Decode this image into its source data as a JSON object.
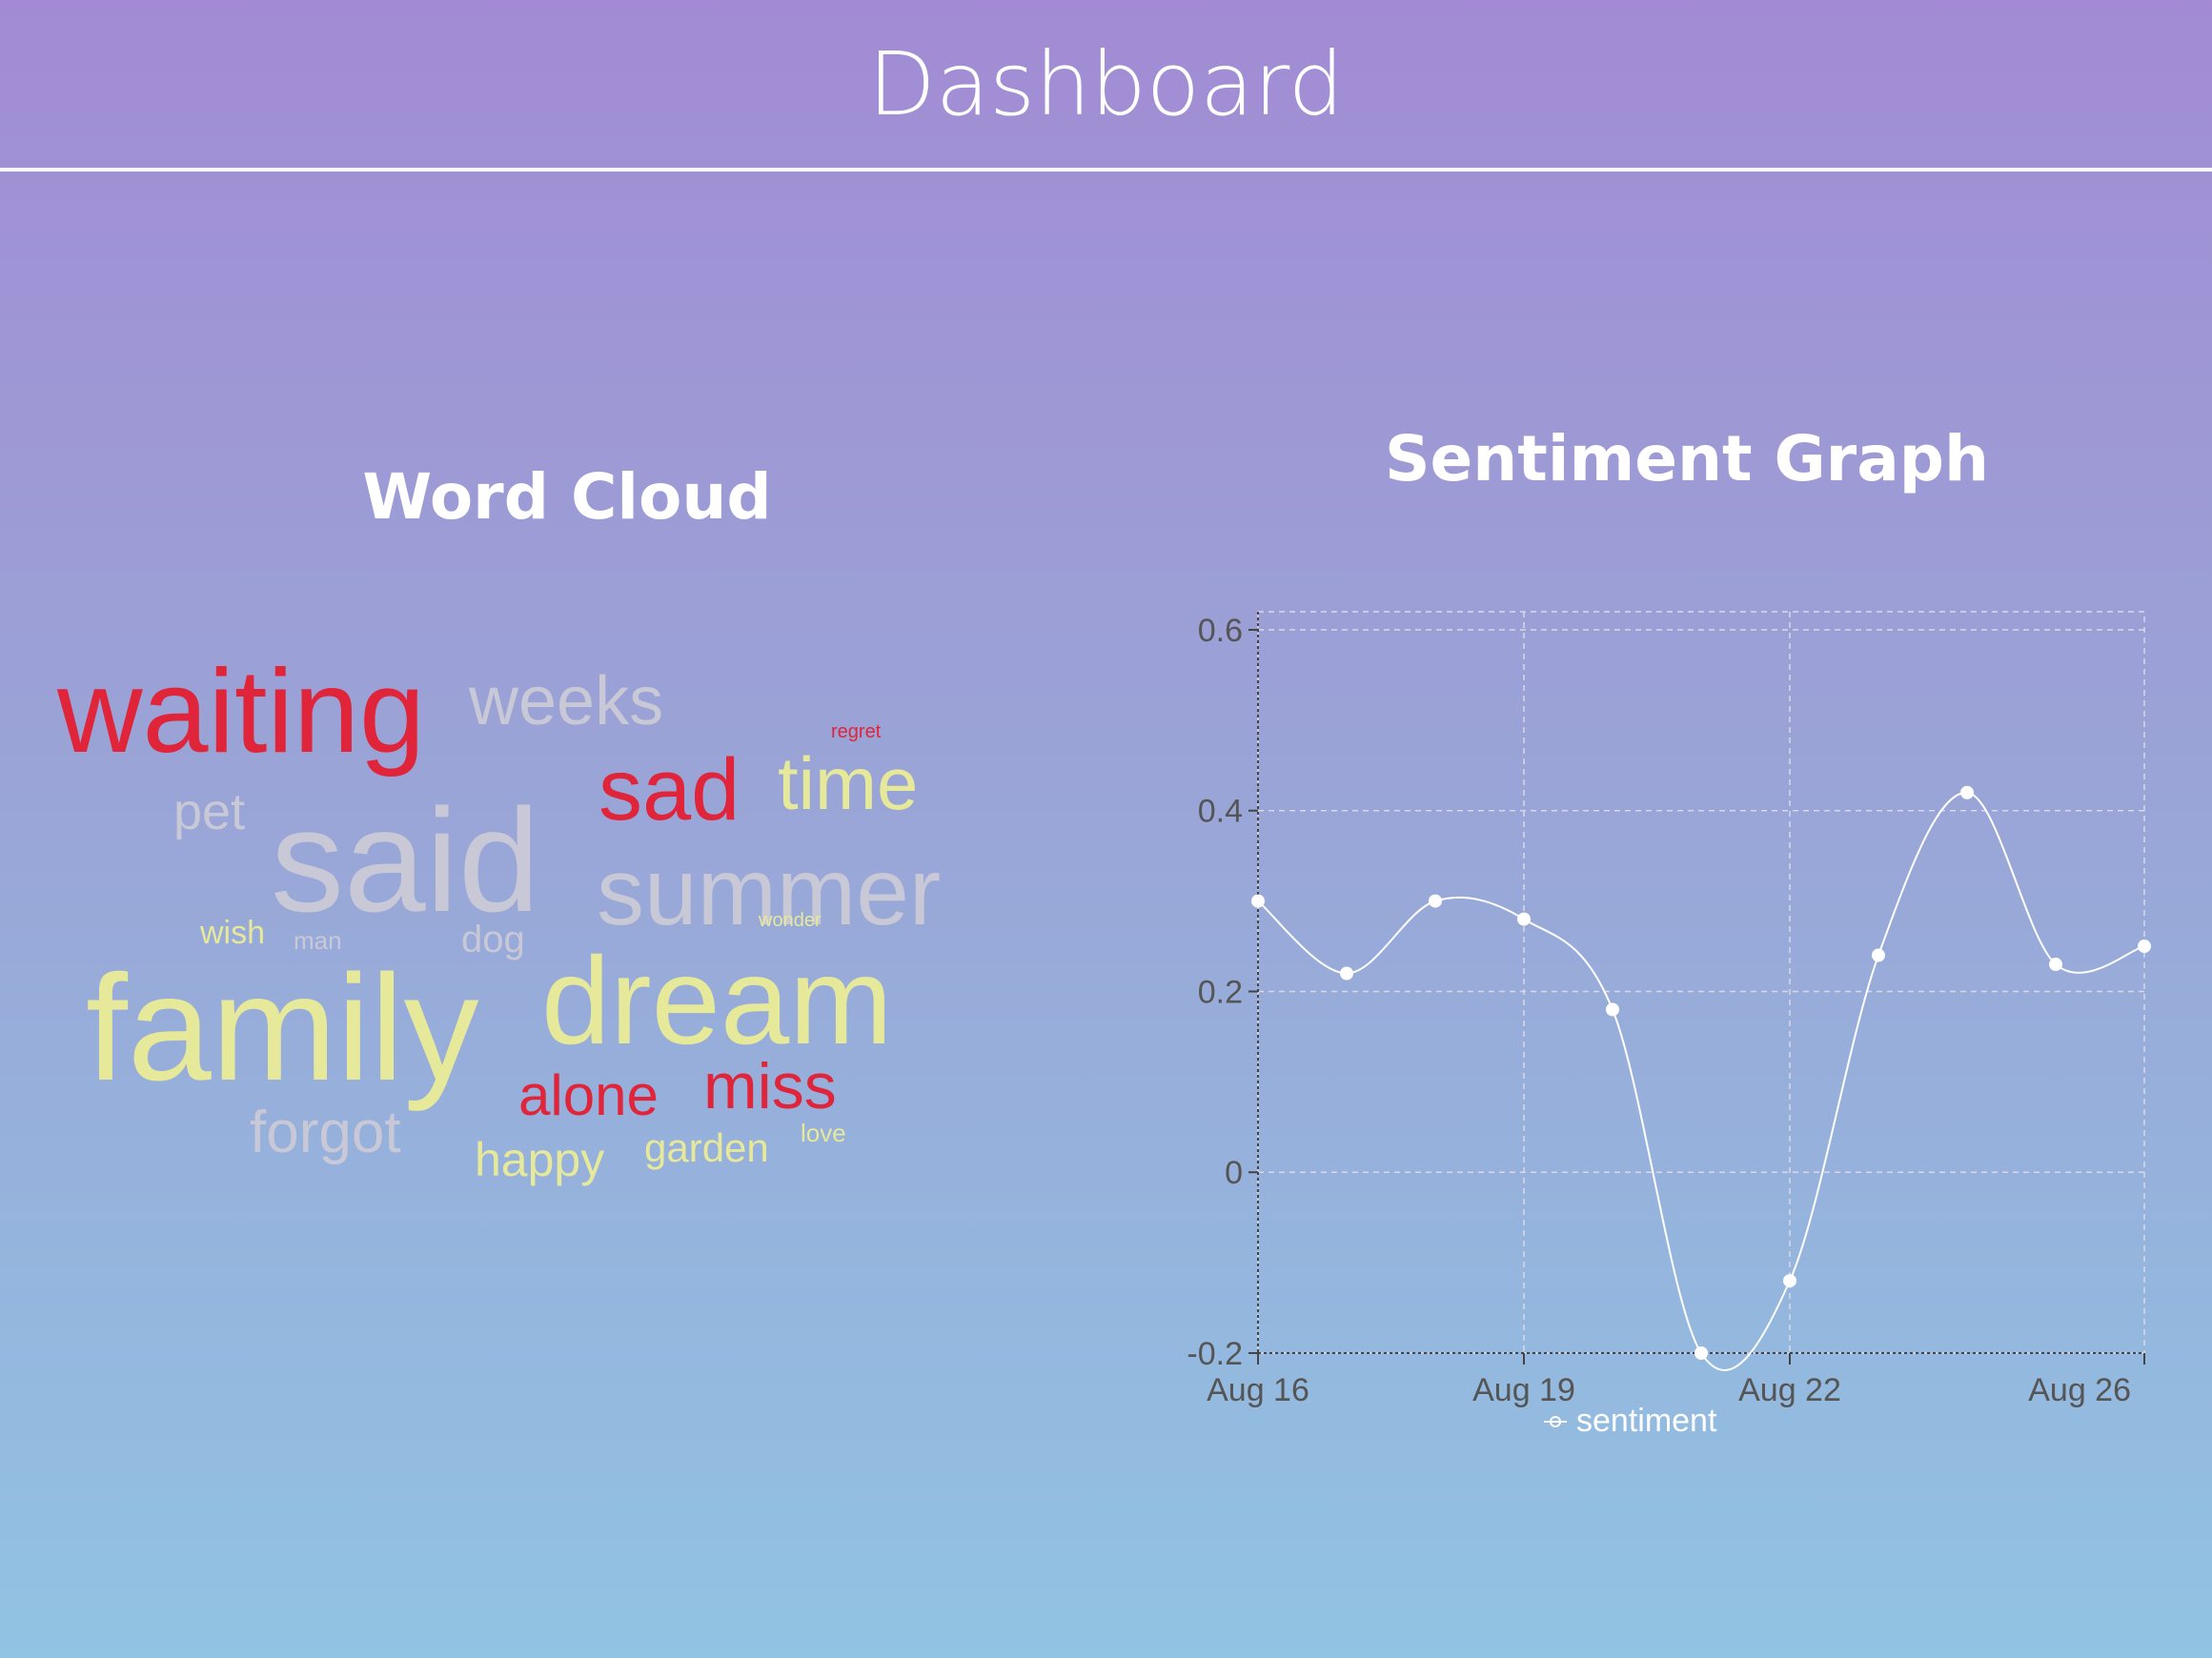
{
  "header": {
    "title": "Dashboard"
  },
  "word_cloud": {
    "title": "Word Cloud",
    "words": [
      {
        "text": "waiting",
        "color": "#e0243a"
      },
      {
        "text": "weeks",
        "color": "#c8c8d6"
      },
      {
        "text": "regret",
        "color": "#e0243a"
      },
      {
        "text": "sad",
        "color": "#e0243a"
      },
      {
        "text": "time",
        "color": "#e6e89a"
      },
      {
        "text": "pet",
        "color": "#c8c8d6"
      },
      {
        "text": "said",
        "color": "#c8c8d6"
      },
      {
        "text": "summer",
        "color": "#c8c8d6"
      },
      {
        "text": "wish",
        "color": "#e6e89a"
      },
      {
        "text": "man",
        "color": "#c8c8d6"
      },
      {
        "text": "dog",
        "color": "#c8c8d6"
      },
      {
        "text": "wonder",
        "color": "#e6e89a"
      },
      {
        "text": "family",
        "color": "#e6e89a"
      },
      {
        "text": "dream",
        "color": "#e6e89a"
      },
      {
        "text": "alone",
        "color": "#e0243a"
      },
      {
        "text": "miss",
        "color": "#e0243a"
      },
      {
        "text": "forgot",
        "color": "#c8c8d6"
      },
      {
        "text": "happy",
        "color": "#e6e89a"
      },
      {
        "text": "garden",
        "color": "#e6e89a"
      },
      {
        "text": "love",
        "color": "#e6e89a"
      }
    ]
  },
  "sentiment_graph": {
    "title": "Sentiment Graph"
  },
  "chart_data": {
    "type": "line",
    "title": "Sentiment Graph",
    "xlabel": "",
    "ylabel": "",
    "x": [
      "2023-08-16",
      "2023-08-17",
      "2023-08-18",
      "2023-08-19",
      "2023-08-20",
      "2023-08-21",
      "2023-08-22",
      "2023-08-23",
      "2023-08-24",
      "2023-08-25",
      "2023-08-26"
    ],
    "x_tick_labels": [
      "Aug 16",
      "Aug 19",
      "Aug 22",
      "Aug 26"
    ],
    "y_tick_labels": [
      "-0.2",
      "0",
      "0.2",
      "0.4",
      "0.6"
    ],
    "ylim": [
      -0.2,
      0.62
    ],
    "series": [
      {
        "name": "sentiment",
        "values": [
          0.3,
          0.22,
          0.3,
          0.28,
          0.18,
          -0.2,
          -0.12,
          0.24,
          0.42,
          0.23,
          0.25
        ]
      }
    ],
    "line_color": "#ffffff",
    "grid": true,
    "legend": "bottom"
  }
}
